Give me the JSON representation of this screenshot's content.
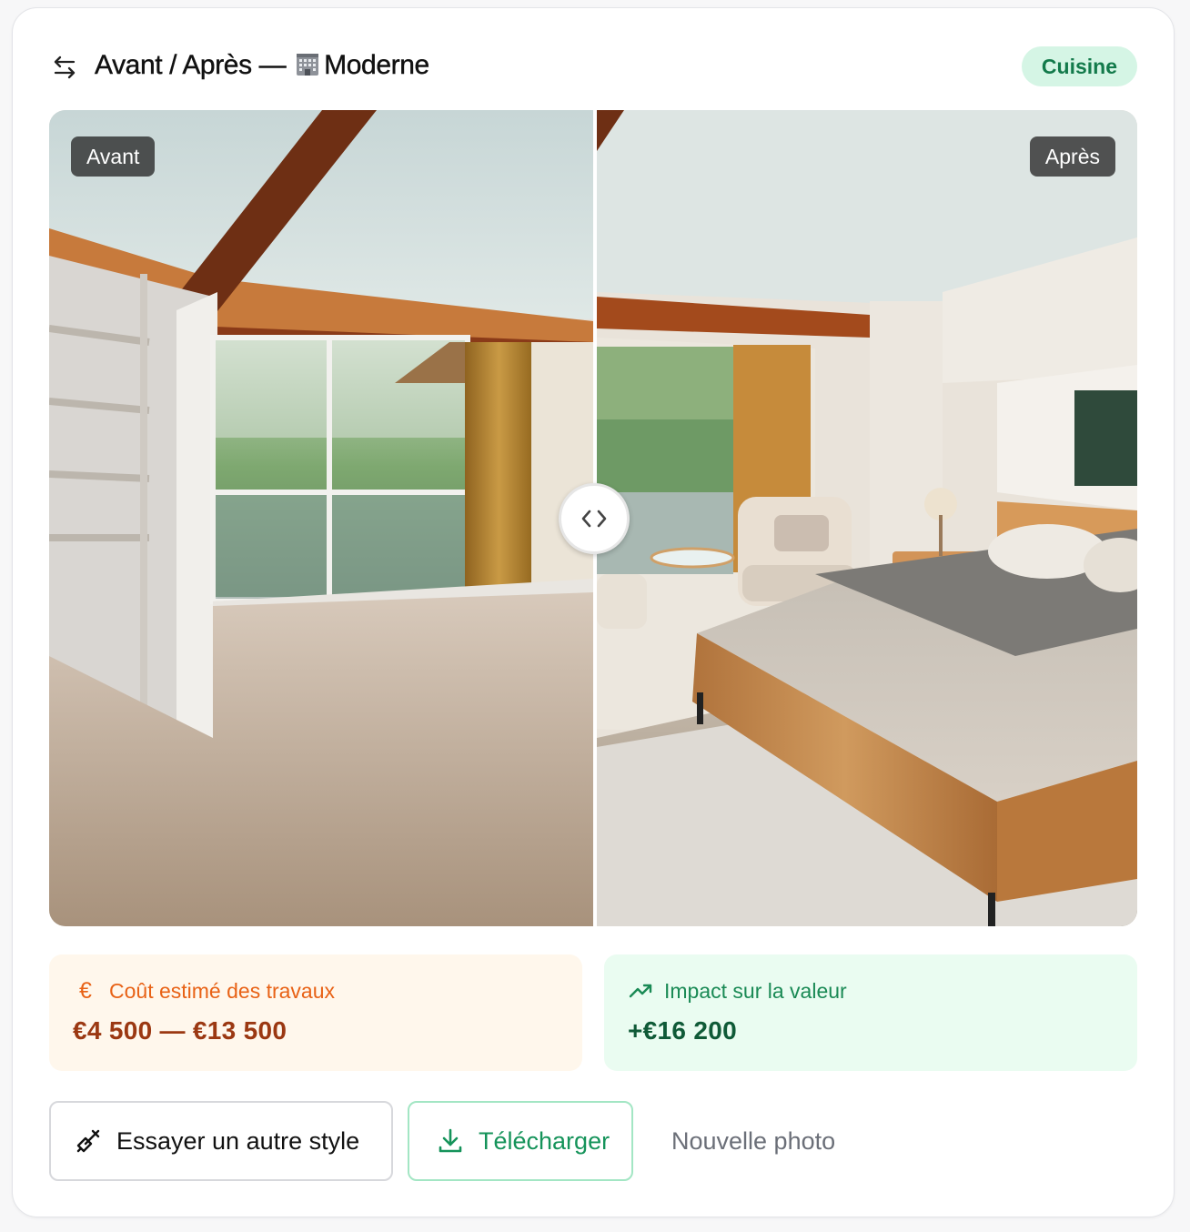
{
  "header": {
    "title_prefix": "Avant / Après —",
    "title_style": "Moderne",
    "style_icon": "office-building-icon",
    "room_badge": "Cuisine"
  },
  "compare": {
    "before_label": "Avant",
    "after_label": "Après",
    "handle_icon": "code-chevrons-icon"
  },
  "stats": {
    "cost": {
      "icon": "euro-icon",
      "label": "Coût estimé des travaux",
      "value": "€4 500 — €13 500",
      "color": "#e86216"
    },
    "value": {
      "icon": "trending-up-icon",
      "label": "Impact sur la valeur",
      "value": "+€16 200",
      "color": "#1a8a55"
    }
  },
  "actions": {
    "try_style": "Essayer un autre style",
    "download": "Télécharger",
    "new_photo": "Nouvelle photo"
  },
  "colors": {
    "accent_green": "#15935a",
    "badge_bg": "#d5f5e5",
    "cost_bg": "#fff7ec",
    "value_bg": "#eafcf1"
  }
}
